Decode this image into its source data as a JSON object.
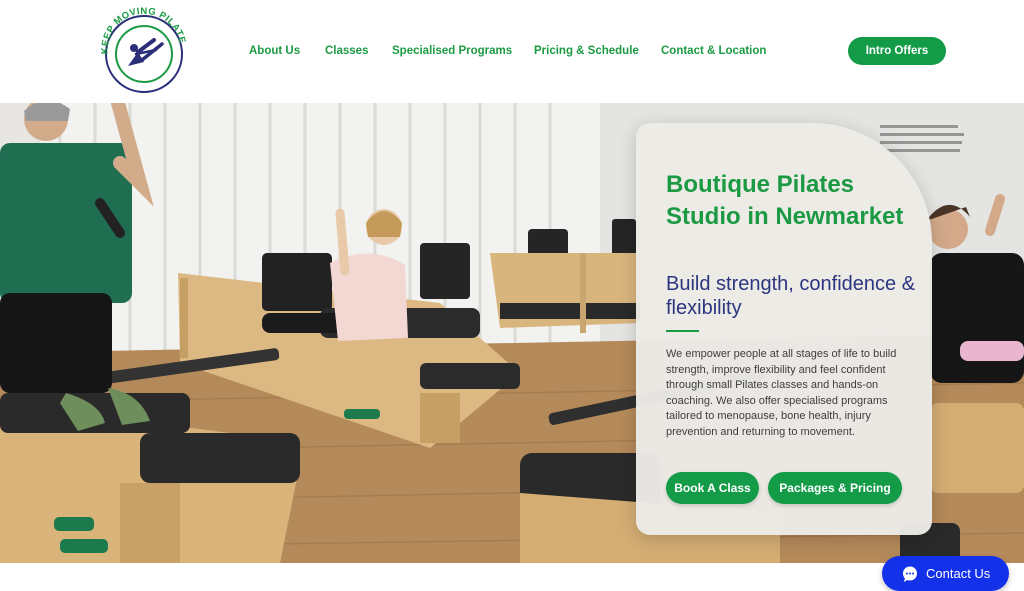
{
  "brand": {
    "logo_text": "KEEP MOVING PILATES"
  },
  "nav": {
    "items": [
      {
        "label": "About Us"
      },
      {
        "label": "Classes"
      },
      {
        "label": "Specialised Programs"
      },
      {
        "label": "Pricing & Schedule"
      },
      {
        "label": "Contact & Location"
      }
    ],
    "cta_label": "Intro Offers"
  },
  "hero": {
    "title": "Boutique Pilates Studio in Newmarket",
    "subtitle": "Build strength, confidence & flexibility",
    "body": "We empower people at all stages of life to build strength, improve flexibility and feel confident through small Pilates classes and hands-on coaching. We also offer specialised programs tailored to menopause, bone health, injury prevention and returning to movement.",
    "buttons": {
      "book": "Book A Class",
      "packages": "Packages & Pricing"
    }
  },
  "chat_widget": {
    "label": "Contact Us",
    "icon": "chat-bubble-icon"
  },
  "colors": {
    "brand_green": "#1c9a43",
    "button_green": "#139b48",
    "navy": "#2b3680",
    "chat_blue": "#1431ea"
  }
}
